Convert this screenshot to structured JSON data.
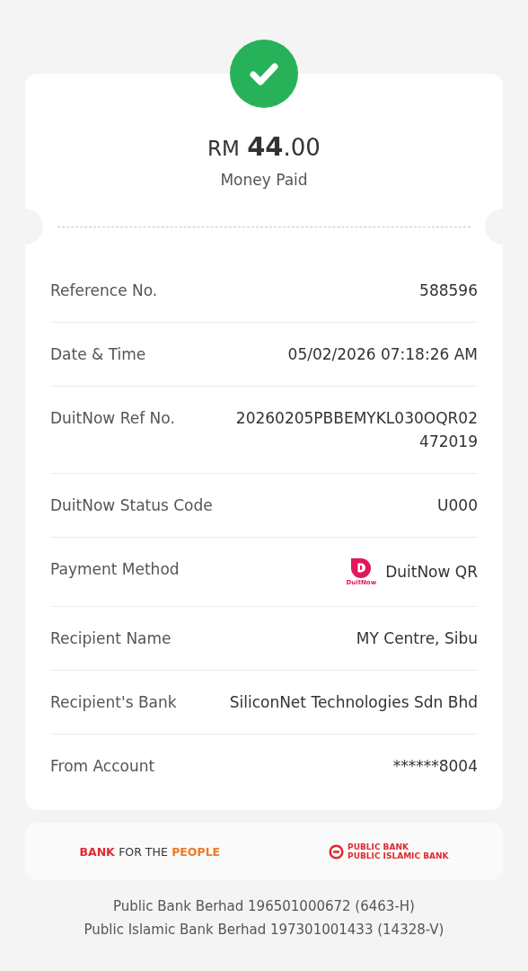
{
  "receipt": {
    "currency": "RM",
    "amount_whole": "44",
    "amount_decimal": ".00",
    "caption": "Money Paid"
  },
  "details": [
    {
      "label": "Reference No.",
      "value": "588596"
    },
    {
      "label": "Date & Time",
      "value": "05/02/2026 07:18:26 AM"
    },
    {
      "label": "DuitNow Ref No.",
      "value": "20260205PBBEMYKL030OQR02472019"
    },
    {
      "label": "DuitNow Status Code",
      "value": "U000"
    },
    {
      "label": "Payment Method",
      "value": "DuitNow QR",
      "kind": "duitnow",
      "logo_text": "DuitNow"
    },
    {
      "label": "Recipient Name",
      "value": "MY Centre, Sibu"
    },
    {
      "label": "Recipient's Bank",
      "value": "SiliconNet Technologies Sdn Bhd"
    },
    {
      "label": "From Account",
      "value": "******8004"
    }
  ],
  "footer": {
    "tagline": [
      {
        "text": "BANK",
        "color": "#e02a2f"
      },
      {
        "text": "FOR THE",
        "color": "#333333"
      },
      {
        "text": "PEOPLE",
        "color": "#ee7a22"
      }
    ],
    "bank_logo_lines": [
      "PUBLIC BANK",
      "PUBLIC ISLAMIC BANK"
    ],
    "registrations": [
      "Public Bank Berhad 196501000672 (6463-H)",
      "Public Islamic Bank Berhad 197301001433 (14328-V)"
    ]
  }
}
